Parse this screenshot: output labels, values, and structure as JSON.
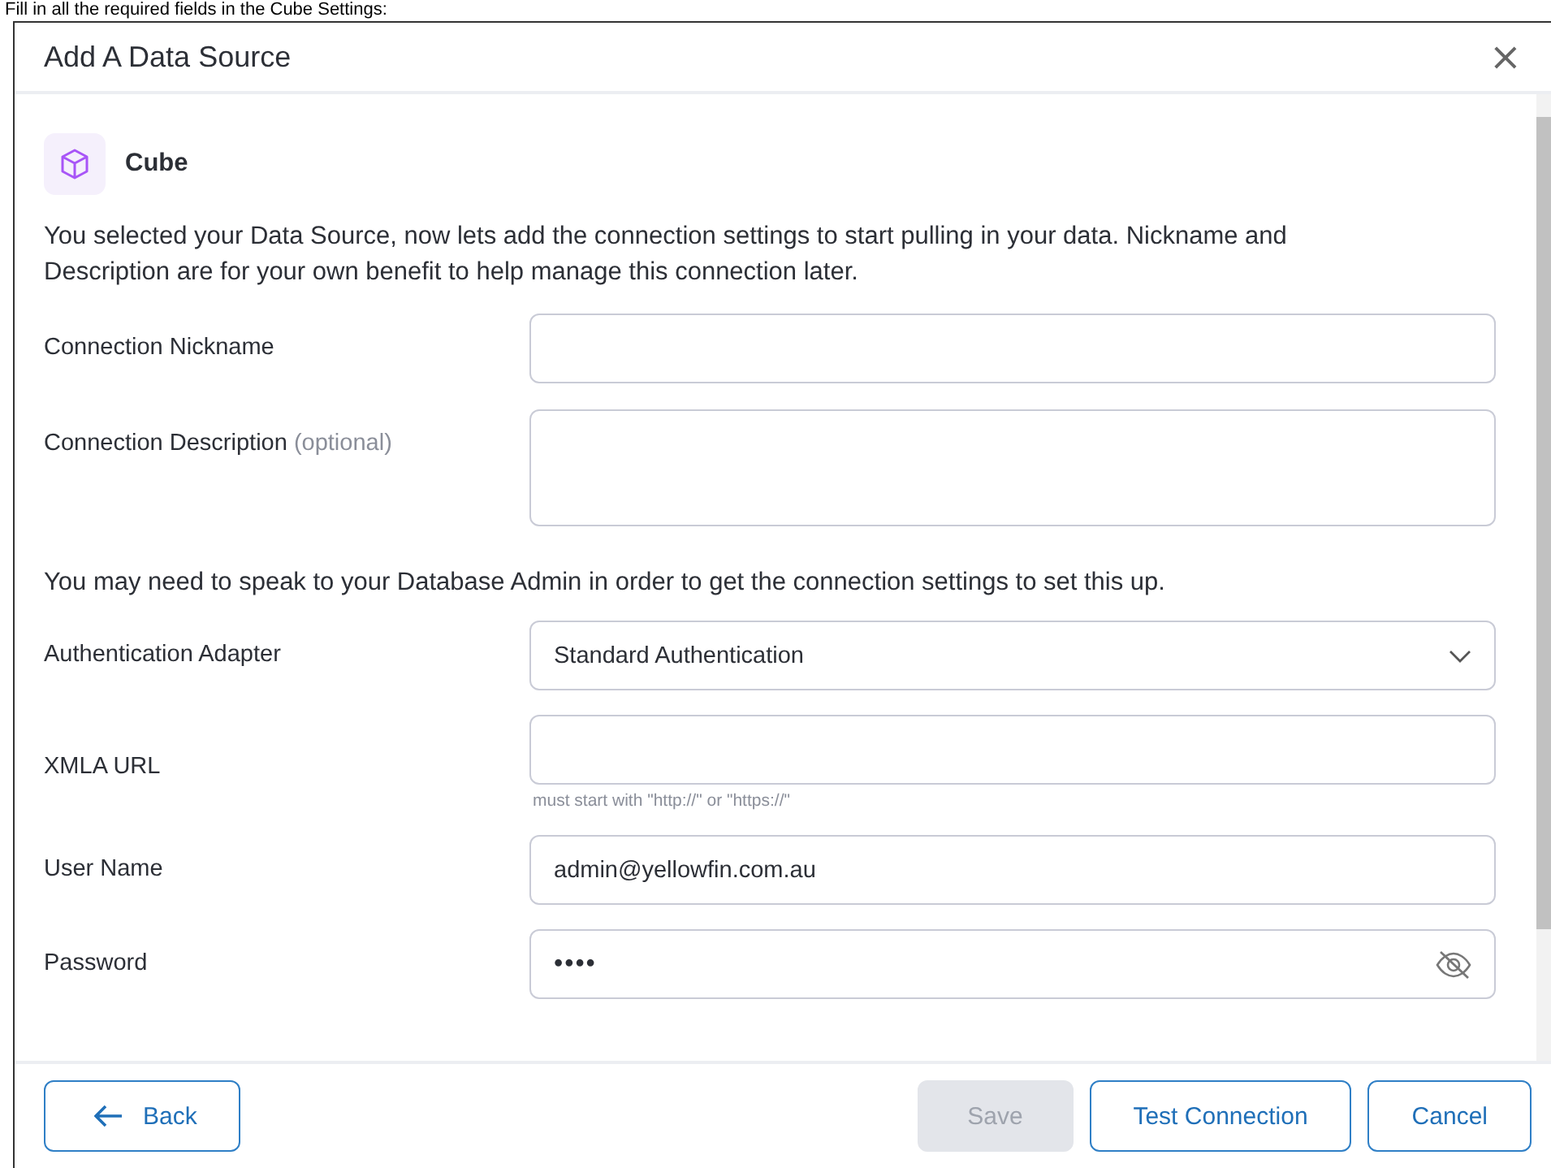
{
  "caption": "Fill in all the required fields in the Cube Settings:",
  "dialog": {
    "title": "Add A Data Source",
    "close": "×"
  },
  "source": {
    "name": "Cube"
  },
  "intro": "You selected your Data Source, now lets add the connection settings to start pulling in your data. Nickname and Description are for your own benefit to help manage this connection later.",
  "fields_top": [
    {
      "label": "Connection Nickname",
      "kind": "text"
    },
    {
      "label": "Connection Description",
      "note": "(optional)",
      "kind": "textarea"
    }
  ],
  "notice": "You may need to speak to your Database Admin in order to get the connection settings to set this up.",
  "fields_bottom": [
    {
      "label": "Authentication Adapter",
      "kind": "select",
      "value": "Standard Authentication"
    },
    {
      "label": "XMLA URL",
      "kind": "text",
      "hint": "must start with \"http://\" or \"https://\""
    },
    {
      "label": "User Name",
      "kind": "text",
      "value": "admin@yellowfin.com.au"
    },
    {
      "label": "Password",
      "kind": "password",
      "value": "••••"
    }
  ],
  "buttons": [
    {
      "label": "Back",
      "kind": "back",
      "disabled": false
    },
    {
      "label": "Save",
      "kind": "plain",
      "disabled": true
    },
    {
      "label": "Test Connection",
      "kind": "plain",
      "disabled": false
    },
    {
      "label": "Cancel",
      "kind": "plain",
      "disabled": false
    }
  ]
}
